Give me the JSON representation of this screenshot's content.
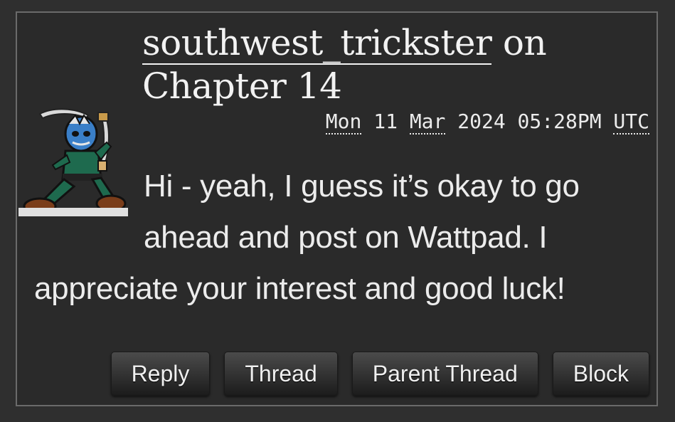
{
  "comment": {
    "author": "southwest_trickster",
    "on_word": "on",
    "chapter": "Chapter 14",
    "date": {
      "weekday": "Mon",
      "day": "11",
      "month": "Mar",
      "year": "2024",
      "time": "05:28PM",
      "timezone": "UTC"
    },
    "text": "Hi - yeah, I guess it’s okay to go ahead and post on Wattpad. I appreciate your interest and good luck!"
  },
  "actions": {
    "reply": "Reply",
    "thread": "Thread",
    "parent_thread": "Parent Thread",
    "block": "Block"
  },
  "avatar": {
    "icon": "blue-spirit-masked-swordsman-icon"
  }
}
